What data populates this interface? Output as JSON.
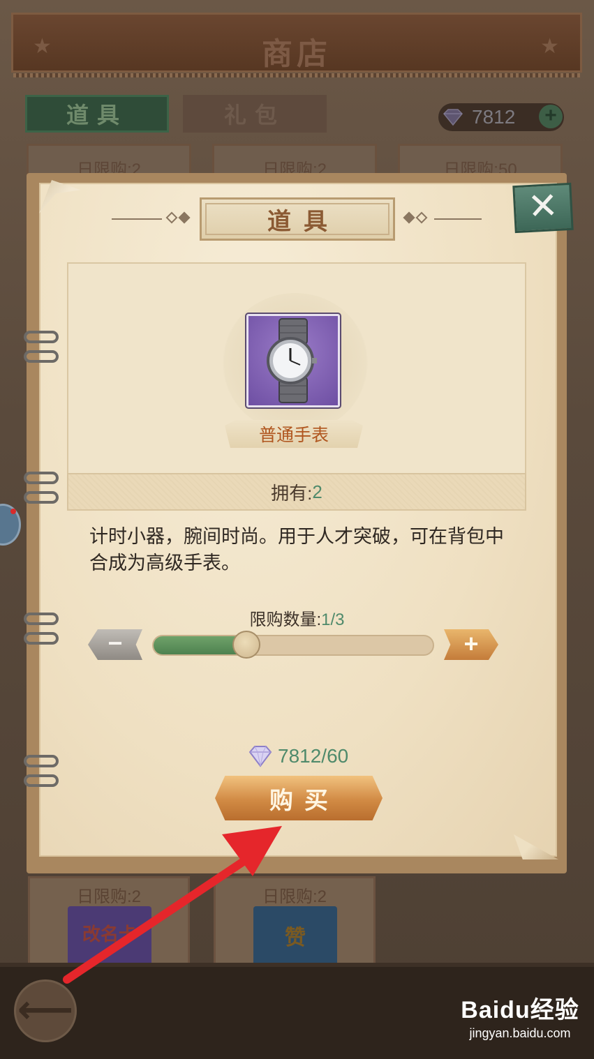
{
  "shop": {
    "title": "商店",
    "tabs": [
      {
        "label": "道具",
        "active": true
      },
      {
        "label": "礼包",
        "active": false
      }
    ],
    "currency": {
      "amount": "7812",
      "icon": "diamond-icon"
    },
    "cards_top": [
      "日限购:2",
      "日限购:2",
      "日限购:50"
    ],
    "cards_bottom": [
      {
        "limit": "日限购:2",
        "thumb_text": "改名卡"
      },
      {
        "limit": "日限购:2",
        "thumb_text": "赞"
      }
    ]
  },
  "dialog": {
    "title": "道具",
    "close_icon": "close-icon",
    "item": {
      "name": "普通手表",
      "icon": "wristwatch-icon",
      "owned_label": "拥有:",
      "owned_count": "2"
    },
    "description": "计时小器，腕间时尚。用于人才突破，可在背包中合成为高级手表。",
    "quantity": {
      "label": "限购数量:",
      "value": "1/3",
      "current": 1,
      "max": 3,
      "minus_icon": "minus-icon",
      "plus_icon": "plus-icon"
    },
    "price": {
      "text": "7812/60",
      "icon": "diamond-icon"
    },
    "buy_label": "购买"
  },
  "watermark": {
    "brand": "Baidu经验",
    "url": "jingyan.baidu.com"
  },
  "colors": {
    "accent_green": "#4f8a6b",
    "button_orange": "#d18a44",
    "item_name": "#b0561f",
    "annotation_arrow": "#e5262b"
  }
}
